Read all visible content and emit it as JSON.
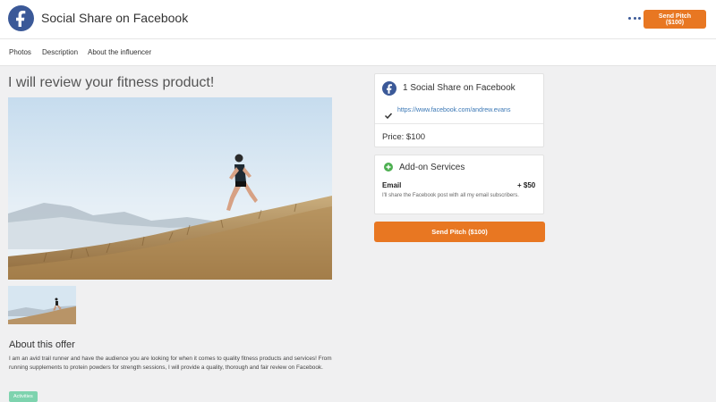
{
  "header": {
    "brand_icon": "facebook-icon",
    "title": "Social Share on Facebook",
    "more_icon": "more-dots-icon",
    "cta_label": "Send Pitch ($100)"
  },
  "tabs": [
    {
      "label": "Photos"
    },
    {
      "label": "Description"
    },
    {
      "label": "About the influencer"
    }
  ],
  "offer": {
    "title": "I will review your fitness product!",
    "about_heading": "About this offer",
    "about_text": "I am an avid trail runner and have the audience you are looking for when it comes to quality fitness products and services! From running supplements to protein powders for strength sessions, I will provide a quality, thorough and fair review on Facebook.",
    "tag": "Activities"
  },
  "sidebar": {
    "package": {
      "icon": "facebook-icon",
      "title": "1 Social Share on Facebook",
      "link_icon": "check-icon",
      "link": "https://www.facebook.com/andrew.evans",
      "price": "Price: $100"
    },
    "addons": {
      "icon": "plus-circle-icon",
      "title": "Add-on Services",
      "item_name": "Email",
      "item_price": "+ $50",
      "item_desc": "I'll share the Facebook post with all my email subscribers."
    },
    "cta_label": "Send Pitch ($100)"
  },
  "colors": {
    "facebook": "#3b5998",
    "accent": "#e87722",
    "link": "#3a77b5",
    "tag": "#7ed3ae",
    "addon_icon": "#4caf50"
  }
}
